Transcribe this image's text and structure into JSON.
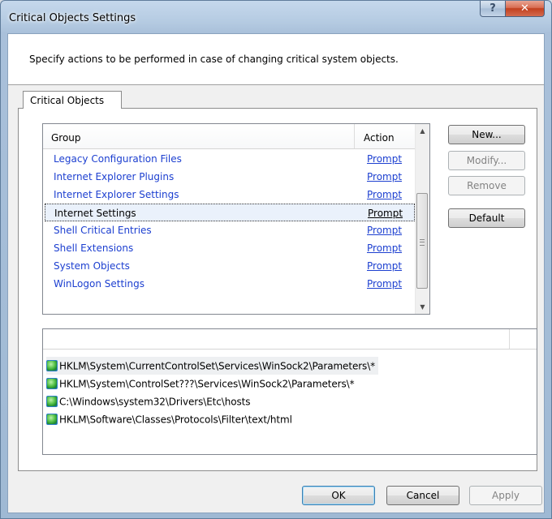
{
  "window": {
    "title": "Critical Objects Settings",
    "help_label": "?",
    "close_label": "✕"
  },
  "description": "Specify actions to be performed in case of changing critical system objects.",
  "tab": {
    "label": "Critical Objects"
  },
  "list": {
    "columns": {
      "group": "Group",
      "action": "Action"
    },
    "rows": [
      {
        "group": "Legacy Configuration Files",
        "action": "Prompt",
        "selected": false
      },
      {
        "group": "Internet Explorer Plugins",
        "action": "Prompt",
        "selected": false
      },
      {
        "group": "Internet Explorer Settings",
        "action": "Prompt",
        "selected": false
      },
      {
        "group": "Internet Settings",
        "action": "Prompt",
        "selected": true
      },
      {
        "group": "Shell Critical Entries",
        "action": "Prompt",
        "selected": false
      },
      {
        "group": "Shell Extensions",
        "action": "Prompt",
        "selected": false
      },
      {
        "group": "System Objects",
        "action": "Prompt",
        "selected": false
      },
      {
        "group": "WinLogon Settings",
        "action": "Prompt",
        "selected": false
      }
    ],
    "scroll": {
      "up_icon": "▲",
      "down_icon": "▼"
    }
  },
  "side_buttons": {
    "new": "New...",
    "modify": "Modify...",
    "remove": "Remove",
    "default": "Default"
  },
  "paths": [
    {
      "icon": "globe-icon",
      "text": "HKLM\\System\\CurrentControlSet\\Services\\WinSock2\\Parameters\\*"
    },
    {
      "icon": "globe-icon",
      "text": "HKLM\\System\\ControlSet???\\Services\\WinSock2\\Parameters\\*"
    },
    {
      "icon": "globe-icon",
      "text": "C:\\Windows\\system32\\Drivers\\Etc\\hosts"
    },
    {
      "icon": "globe-icon",
      "text": "HKLM\\Software\\Classes\\Protocols\\Filter\\text/html"
    }
  ],
  "footer": {
    "ok": "OK",
    "cancel": "Cancel",
    "apply": "Apply"
  }
}
